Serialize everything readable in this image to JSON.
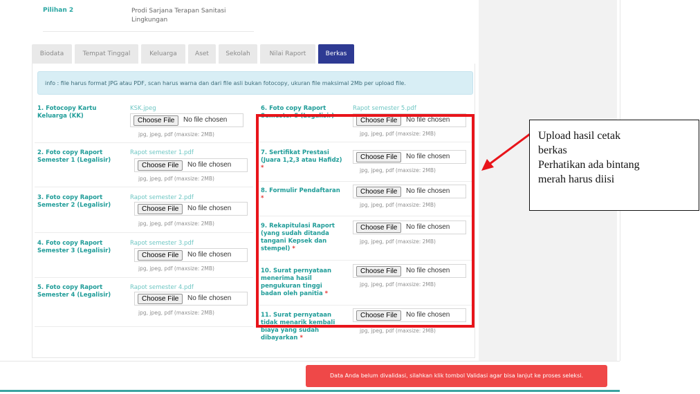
{
  "pilihan": {
    "label": "Pilihan 2",
    "value": "Prodi Sarjana Terapan Sanitasi Lingkungan"
  },
  "tabs": [
    {
      "label": "Biodata",
      "active": false
    },
    {
      "label": "Tempat Tinggal",
      "active": false
    },
    {
      "label": "Keluarga",
      "active": false
    },
    {
      "label": "Aset",
      "active": false
    },
    {
      "label": "Sekolah",
      "active": false
    },
    {
      "label": "Nilai Raport",
      "active": false
    },
    {
      "label": "Berkas",
      "active": true
    }
  ],
  "info": "info : file harus format JPG atau PDF, scan harus warna dan dari file asli bukan fotocopy, ukuran file maksimal 2Mb per upload file.",
  "file_input": {
    "button": "Choose File",
    "status": "No file chosen",
    "hint": "jpg, jpeg, pdf (maxsize: 2MB)"
  },
  "left_items": [
    {
      "label": "1. Fotocopy Kartu Keluarga (KK)",
      "file": "KSK.jpeg"
    },
    {
      "label": "2. Foto copy Raport Semester 1 (Legalisir)",
      "file": "Rapot semester 1.pdf"
    },
    {
      "label": "3. Foto copy Raport Semester 2 (Legalisir)",
      "file": "Rapot semester 2.pdf"
    },
    {
      "label": "4. Foto copy Raport Semester 3 (Legalisir)",
      "file": "Rapot semester 3.pdf"
    },
    {
      "label": "5. Foto copy Raport Semester 4 (Legalisir)",
      "file": "Rapot semester 4.pdf"
    }
  ],
  "right_items": [
    {
      "label": "6. Foto copy Raport Semester 5 (Legalisir)",
      "file": "Rapot semester 5.pdf",
      "required": false
    },
    {
      "label": "7. Sertifikat Prestasi (Juara 1,2,3 atau Hafidz)",
      "file": "",
      "required": true
    },
    {
      "label": "8. Formulir Pendaftaran",
      "file": "",
      "required": true
    },
    {
      "label": "9. Rekapitulasi Raport (yang sudah ditanda tangani Kepsek dan stempel)",
      "file": "",
      "required": true
    },
    {
      "label": "10. Surat pernyataan menerima hasil pengukuran tinggi badan oleh panitia",
      "file": "",
      "required": true
    },
    {
      "label": "11. Surat pernyataan tidak menarik kembali biaya yang sudah dibayarkan",
      "file": "",
      "required": true
    }
  ],
  "required_mark": "*",
  "annotation": {
    "line1": "Upload hasil cetak",
    "line2": "berkas",
    "line3": "Perhatikan ada bintang",
    "line4": "merah harus diisi"
  },
  "alert": "Data Anda belum divalidasi, silahkan klik tombol Validasi agar bisa lanjut ke proses seleksi.",
  "colors": {
    "accent": "#2e3a93",
    "teal": "#1f9c98",
    "alert": "#ef4848",
    "highlight": "#e8141a"
  }
}
